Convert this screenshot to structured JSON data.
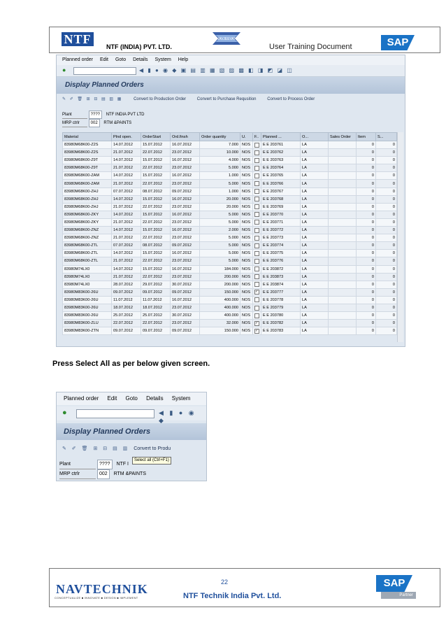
{
  "header": {
    "logo_text": "NTF",
    "company": "NTF (INDIA) PVT. LTD.",
    "navjeevan_logo_text": "NAVJEEVAN",
    "doc_title": "User Training Document",
    "sap_logo": "SAP"
  },
  "sap_screen": {
    "menu": [
      "Planned order",
      "Edit",
      "Goto",
      "Details",
      "System",
      "Help"
    ],
    "title": "Display Planned Orders",
    "app_toolbar_icons": "✎ ✐ 🗑 ⊞ ⊟ ▤ ▥ ▦",
    "actions": [
      "Convert to Production Order",
      "Convert to Purchase Requsition",
      "Convert to Process Order"
    ],
    "plant_label": "Plant",
    "plant_value": "????",
    "plant_desc": "NTF INDIA PVT LTD",
    "mrp_label": "MRP ctrlr",
    "mrp_value": "002",
    "mrp_desc": "RTM &PAINTS",
    "columns": [
      "Material",
      "Plnd open.",
      "OrderStart",
      "Ord.finsh",
      "Order quantity",
      "U.",
      "F..",
      "Planned ...",
      "O...",
      "Sales Order",
      "Item",
      "S..."
    ],
    "rows": [
      [
        "83980M68K00-Z2S",
        "14.07.2012",
        "15.07.2012",
        "16.07.2012",
        "7.000",
        "NOS",
        "",
        "E E 203761",
        "LA",
        "",
        "0",
        "0"
      ],
      [
        "83980M68K00-Z2S",
        "21.07.2012",
        "22.07.2012",
        "23.07.2012",
        "10.000",
        "NOS",
        "",
        "E E 203762",
        "LA",
        "",
        "0",
        "0"
      ],
      [
        "83980M68K00-Z9T",
        "14.07.2012",
        "15.07.2012",
        "16.07.2012",
        "4.000",
        "NOS",
        "",
        "E E 203763",
        "LA",
        "",
        "0",
        "0"
      ],
      [
        "83980M68K00-Z9T",
        "21.07.2012",
        "22.07.2012",
        "23.07.2012",
        "5.000",
        "NOS",
        "",
        "E E 203764",
        "LA",
        "",
        "0",
        "0"
      ],
      [
        "83980M68K00-ZAM",
        "14.07.2012",
        "15.07.2012",
        "16.07.2012",
        "1.000",
        "NOS",
        "",
        "E E 203765",
        "LA",
        "",
        "0",
        "0"
      ],
      [
        "83980M68K00-ZAM",
        "21.07.2012",
        "22.07.2012",
        "23.07.2012",
        "5.000",
        "NOS",
        "",
        "E E 203766",
        "LA",
        "",
        "0",
        "0"
      ],
      [
        "83980M68K00-ZHJ",
        "07.07.2012",
        "08.07.2012",
        "09.07.2012",
        "1.000",
        "NOS",
        "",
        "E E 203767",
        "LA",
        "",
        "0",
        "0"
      ],
      [
        "83980M68K00-ZHJ",
        "14.07.2012",
        "15.07.2012",
        "16.07.2012",
        "20.000",
        "NOS",
        "",
        "E E 203768",
        "LA",
        "",
        "0",
        "0"
      ],
      [
        "83980M68K00-ZHJ",
        "21.07.2012",
        "22.07.2012",
        "23.07.2012",
        "20.000",
        "NOS",
        "",
        "E E 203769",
        "LA",
        "",
        "0",
        "0"
      ],
      [
        "83980M68K00-ZKY",
        "14.07.2012",
        "15.07.2012",
        "16.07.2012",
        "5.000",
        "NOS",
        "",
        "E E 203770",
        "LA",
        "",
        "0",
        "0"
      ],
      [
        "83980M68K00-ZKY",
        "21.07.2012",
        "22.07.2012",
        "23.07.2012",
        "5.000",
        "NOS",
        "",
        "E E 203771",
        "LA",
        "",
        "0",
        "0"
      ],
      [
        "83980M68K00-ZNZ",
        "14.07.2012",
        "15.07.2012",
        "16.07.2012",
        "2.000",
        "NOS",
        "",
        "E E 203772",
        "LA",
        "",
        "0",
        "0"
      ],
      [
        "83980M68K00-ZNZ",
        "21.07.2012",
        "22.07.2012",
        "23.07.2012",
        "5.000",
        "NOS",
        "",
        "E E 203773",
        "LA",
        "",
        "0",
        "0"
      ],
      [
        "83980M68K00-ZTL",
        "07.07.2012",
        "08.07.2012",
        "09.07.2012",
        "5.000",
        "NOS",
        "",
        "E E 203774",
        "LA",
        "",
        "0",
        "0"
      ],
      [
        "83980M68K00-ZTL",
        "14.07.2012",
        "15.07.2012",
        "16.07.2012",
        "5.000",
        "NOS",
        "",
        "E E 203775",
        "LA",
        "",
        "0",
        "0"
      ],
      [
        "83980M68K00-ZTL",
        "21.07.2012",
        "22.07.2012",
        "23.07.2012",
        "5.000",
        "NOS",
        "",
        "E E 203776",
        "LA",
        "",
        "0",
        "0"
      ],
      [
        "83980M74LX0",
        "14.07.2012",
        "15.07.2012",
        "16.07.2012",
        "184.000",
        "NOS",
        "",
        "E E 203872",
        "LA",
        "",
        "0",
        "0"
      ],
      [
        "83980M74LX0",
        "21.07.2012",
        "22.07.2012",
        "23.07.2012",
        "200.000",
        "NOS",
        "",
        "E E 203873",
        "LA",
        "",
        "0",
        "0"
      ],
      [
        "83980M74LX0",
        "28.07.2012",
        "29.07.2012",
        "30.07.2012",
        "200.000",
        "NOS",
        "",
        "E E 203874",
        "LA",
        "",
        "0",
        "0"
      ],
      [
        "83980M83K00-26U",
        "09.07.2012",
        "09.07.2012",
        "09.07.2012",
        "150.000",
        "NOS",
        "✓",
        "E E 203777",
        "LA",
        "",
        "0",
        "0"
      ],
      [
        "83980M83K00-26U",
        "11.07.2012",
        "11.07.2012",
        "16.07.2012",
        "400.000",
        "NOS",
        "",
        "E E 203778",
        "LA",
        "",
        "0",
        "0"
      ],
      [
        "83980M83K00-26U",
        "18.07.2012",
        "18.07.2012",
        "23.07.2012",
        "400.000",
        "NOS",
        "",
        "E E 203779",
        "LA",
        "",
        "0",
        "0"
      ],
      [
        "83980M83K00-26U",
        "25.07.2012",
        "25.07.2012",
        "30.07.2012",
        "400.000",
        "NOS",
        "",
        "E E 203780",
        "LA",
        "",
        "0",
        "0"
      ],
      [
        "83980M83K00-ZLU",
        "22.07.2012",
        "22.07.2012",
        "23.07.2012",
        "32.000",
        "NOS",
        "✓",
        "E E 203782",
        "LA",
        "",
        "0",
        "0"
      ],
      [
        "83980M83K00-ZTN",
        "09.07.2012",
        "09.07.2012",
        "09.07.2012",
        "150.000",
        "NOS",
        "✓",
        "E E 203783",
        "LA",
        "",
        "0",
        "0"
      ]
    ]
  },
  "caption": "Press Select All as per below given screen.",
  "zoom_screen": {
    "menu": [
      "Planned order",
      "Edit",
      "Goto",
      "Details",
      "System"
    ],
    "title": "Display Planned Orders",
    "action": "Convert to Produ",
    "plant_label": "Plant",
    "plant_value": "????",
    "plant_desc": "NTF I",
    "tooltip": "Select all   (Ctrl+F1)",
    "mrp_label": "MRP ctrlr",
    "mrp_value": "002",
    "mrp_desc": "RTM &PAINTS"
  },
  "footer": {
    "page_number": "22",
    "navtechnik_logo": "NAVTECHNIK",
    "tagline": "CONCEPTUALIZE ■ INNOVATE ■ DESIGN ■ IMPLEMENT",
    "company": "NTF Technik India Pvt. Ltd.",
    "sap_logo": "SAP",
    "partner": "Partner"
  }
}
